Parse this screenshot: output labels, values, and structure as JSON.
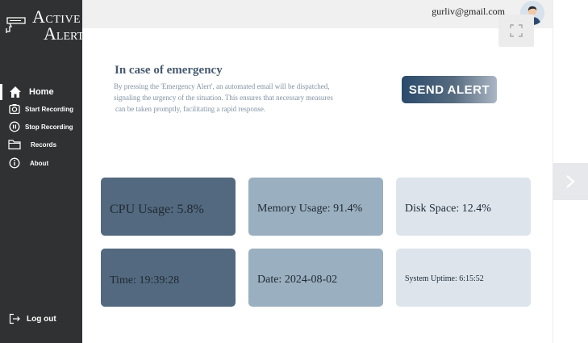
{
  "sidebar": {
    "logo": {
      "line1_cap": "A",
      "line1_rest": "CTIVE",
      "line2_cap": "A",
      "line2_rest": "LERT"
    },
    "items": [
      {
        "label": "Home",
        "icon": "home-icon"
      },
      {
        "label": "Start Recording",
        "icon": "camera-icon"
      },
      {
        "label": "Stop Recording",
        "icon": "pause-icon"
      },
      {
        "label": "Records",
        "icon": "folder-icon"
      },
      {
        "label": "About",
        "icon": "info-icon"
      }
    ],
    "logout": {
      "label": "Log out",
      "icon": "logout-icon"
    }
  },
  "header": {
    "email": "gurliv@gmail.com",
    "avatar_icon": "user-avatar-icon",
    "fullscreen_icon": "fullscreen-icon"
  },
  "emergency": {
    "title": "In case of emergency",
    "desc_lines": [
      "By pressing the 'Emergency Alert', an automated email will be dispatched,",
      "signaling the urgency of the situation. This ensures that necessary measures",
      "can be taken promptly, facilitating a rapid response."
    ],
    "button_label": "SEND ALERT"
  },
  "stats": {
    "cpu": "CPU Usage: 5.8%",
    "memory": "Memory Usage: 91.4%",
    "disk": "Disk Space: 12.4%",
    "time": "Time: 19:39:28",
    "date": "Date: 2024-08-02",
    "uptime": "System Uptime: 6:15:52"
  },
  "colors": {
    "sidebar_bg": "#2f3133",
    "card_dark": "#53697f",
    "card_mid": "#9aafbf",
    "card_light": "#dde4ec",
    "title_color": "#465a70",
    "alert_button": "#2a4a6c"
  },
  "next_icon": "chevron-right-icon"
}
